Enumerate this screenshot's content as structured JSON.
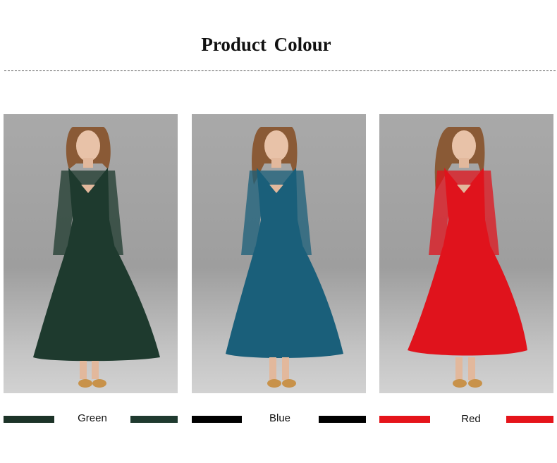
{
  "header": {
    "title": "Product  Colour"
  },
  "variants": [
    {
      "label": "Green",
      "color": "#1e3a2e",
      "bar_color": "#1c3328",
      "bar_color_right": "#1f3a2f"
    },
    {
      "label": "Blue",
      "color": "#1a5f7a",
      "bar_color": "#000000",
      "bar_color_right": "#000000"
    },
    {
      "label": "Red",
      "color": "#e0131c",
      "bar_color": "#e5141a",
      "bar_color_right": "#e5141a"
    }
  ]
}
